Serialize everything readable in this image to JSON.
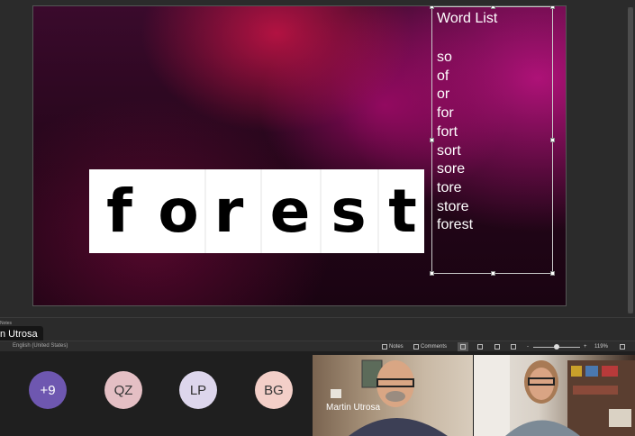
{
  "slide": {
    "main_word_letters": [
      "f",
      "o",
      "r",
      "e",
      "s",
      "t"
    ],
    "word_list_title": "Word List",
    "word_list": [
      "so",
      "of",
      "or",
      "for",
      "fort",
      "sort",
      "sore",
      "tore",
      "store",
      "forest"
    ]
  },
  "editor": {
    "notes_label": "Notes",
    "speaker_name_tag": "n Utrosa"
  },
  "statusbar": {
    "language": "English (United States)",
    "notes_button": "Notes",
    "comments_button": "Comments",
    "zoom_minus": "-",
    "zoom_plus": "+",
    "zoom_level": "119%",
    "zoom_fraction": 0.5
  },
  "meeting": {
    "participants": [
      {
        "label": "+9",
        "bg": "#6e57b0",
        "fg": "#ffffff"
      },
      {
        "label": "QZ",
        "bg": "#e4bfc4",
        "fg": "#333333"
      },
      {
        "label": "LP",
        "bg": "#ddd6ec",
        "fg": "#333333"
      },
      {
        "label": "BG",
        "bg": "#f3cfc8",
        "fg": "#333333"
      }
    ],
    "video_presenter_name": "Martin Utrosa"
  },
  "colors": {
    "slide_accent": "#c8145a",
    "avatar_overflow": "#6e57b0"
  }
}
